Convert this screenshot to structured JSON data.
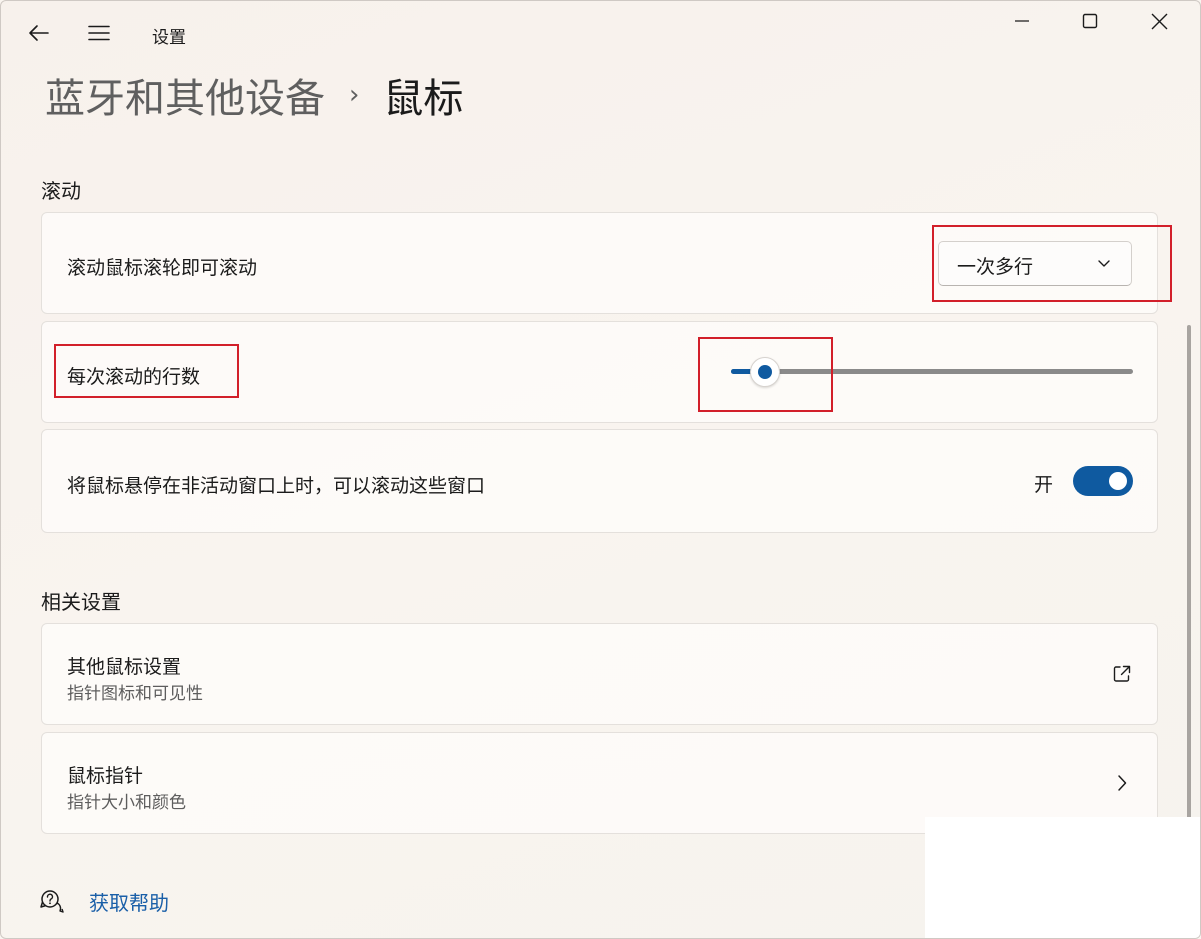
{
  "titlebar": {
    "app_title": "设置",
    "back_icon": "arrow-left-icon",
    "menu_icon": "hamburger-menu-icon",
    "minimize_icon": "minimize-icon",
    "maximize_icon": "maximize-icon",
    "close_icon": "close-icon"
  },
  "breadcrumb": {
    "parent": "蓝牙和其他设备",
    "separator": "›",
    "current": "鼠标"
  },
  "scrolling_section": {
    "title": "滚动",
    "wheel_row": {
      "label": "滚动鼠标滚轮即可滚动",
      "dropdown_value": "一次多行"
    },
    "lines_row": {
      "label": "每次滚动的行数",
      "slider_level_fraction": 0.05
    },
    "inactive_row": {
      "label": "将鼠标悬停在非活动窗口上时，可以滚动这些窗口",
      "toggle_label": "开",
      "toggle_on": true
    }
  },
  "related_section": {
    "title": "相关设置",
    "items": [
      {
        "title": "其他鼠标设置",
        "subtitle": "指针图标和可见性",
        "icon": "open-external-icon"
      },
      {
        "title": "鼠标指针",
        "subtitle": "指针大小和颜色",
        "icon": "chevron-right-icon"
      }
    ]
  },
  "help": {
    "label": "获取帮助",
    "icon": "help-chat-icon"
  },
  "colors": {
    "accent": "#0f5aa0",
    "highlight_box": "#d21f2a",
    "link": "#1a5fa8"
  }
}
